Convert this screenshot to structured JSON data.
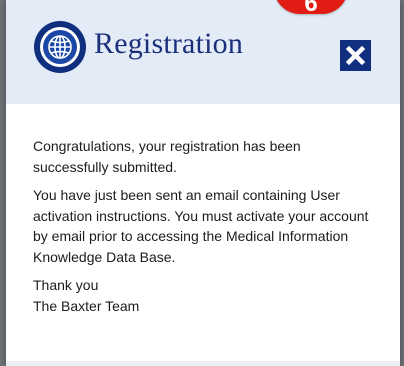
{
  "header": {
    "title": "Registration",
    "logo_icon": "globe-icon",
    "close_icon": "close-icon",
    "step_badge": "6",
    "background_color": "#e3ebf7",
    "title_color": "#1b2f7a",
    "accent_color": "#10307f",
    "badge_color": "#e01c14"
  },
  "body": {
    "paragraph_1": [
      "Congratulations, your registration has been",
      "successfully submitted."
    ],
    "paragraph_2": [
      "You have just been sent an email containing User",
      "activation instructions. You must activate your account",
      "by email prior to accessing the Medical Information",
      "Knowledge Data Base."
    ],
    "closing": [
      "Thank you",
      "The Baxter Team"
    ]
  }
}
